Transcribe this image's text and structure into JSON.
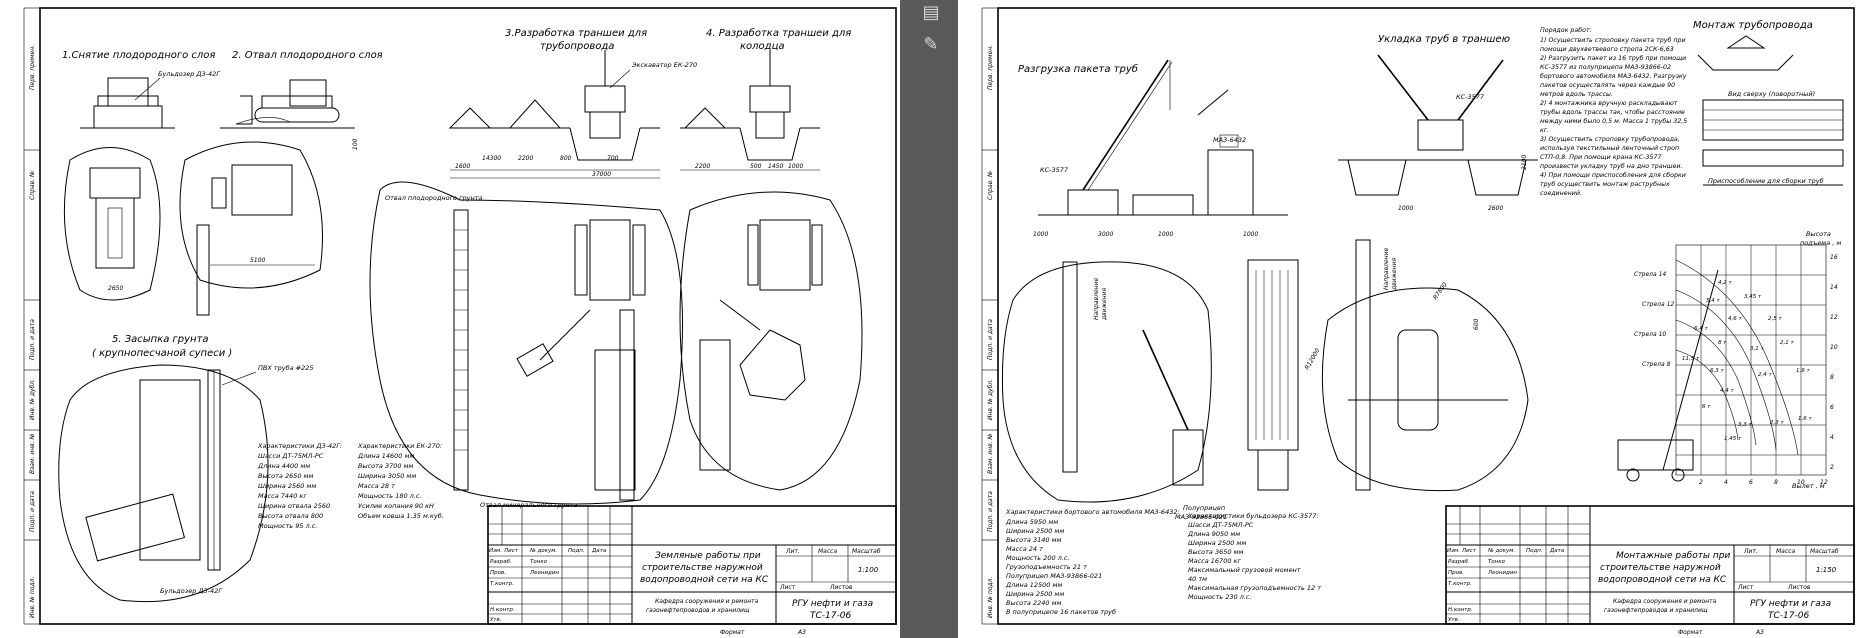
{
  "viewer": {
    "tools": [
      "layers-icon",
      "annotate-icon"
    ]
  },
  "left": {
    "h1": "1.Снятие плодородного слоя",
    "h2": "2. Отвал плодородного слоя",
    "h3a": "3.Разработка траншеи для",
    "h3b": "трубопровода",
    "h4a": "4. Разработка траншеи для",
    "h4b": "колодца",
    "h5a": "5. Засыпка грунта",
    "h5b": "( крупнопесчаной супеси )",
    "lbl_bulldozer": "Бульдозер ДЗ-42Г",
    "lbl_bulldozer2": "Бульдозер ДЗ-42Г",
    "lbl_excavator": "Экскаватор ЕК-270",
    "lbl_otval": "Отвал плодородного грунта",
    "lbl_otval_min": "Отвал минерального грунта",
    "lbl_pipe": "ПВХ труба #225",
    "dims": [
      "1600",
      "14300",
      "2200",
      "800",
      "2200",
      "700",
      "37000",
      "2200",
      "500",
      "1450",
      "1000",
      "5100",
      "2650",
      "1000",
      "100"
    ],
    "specs_dz_title": "Характеристики ДЗ-42Г:",
    "specs_dz": [
      "Шасси ДТ-75МЛ-РС",
      "Длина 4400 мм",
      "Высота 2650 мм",
      "Ширина 2560 мм",
      "Масса 7440 кг",
      "Ширина отвала 2560",
      "Высота отвала 800",
      "Мощность 95 л.с."
    ],
    "specs_ek_title": "Характеристики ЕК-270:",
    "specs_ek": [
      "Длина 14600 мм",
      "Высота 3700 мм",
      "Ширина 3050 мм",
      "Масса 28 т",
      "Мощность 180 л.с.",
      "Усилие копания 90 кН",
      "Объем ковша 1,35 м.куб."
    ],
    "side_labels": [
      "Перв. примен.",
      "Справ. №",
      "Подп. и дата",
      "Инв. № дубл.",
      "Взам. инв. №",
      "Подп. и дата",
      "Инв. № подл."
    ],
    "tb": {
      "title": [
        "Земляные работы при",
        "строительстве наружной",
        "водопроводной сети на КС"
      ],
      "hdr": [
        "Изм.",
        "Лист",
        "№ докум.",
        "Подп.",
        "Дата"
      ],
      "rows": [
        "Разраб.",
        "Пров.",
        "Т.контр.",
        "",
        "Н.контр.",
        "Утв."
      ],
      "names": [
        "Тонко",
        "Леонидин"
      ],
      "lit": "Лит.",
      "mass": "Масса",
      "scale_h": "Масштаб",
      "scale": "1:100",
      "sheet": "Лист",
      "sheets": "Листов",
      "dept": [
        "Кафедра сооружения и ремонта",
        "газонефтепроводов и хранилищ"
      ],
      "org": [
        "РГУ нефти и газа",
        "ТС-17-06"
      ],
      "format_l": "Формат",
      "format": "А3"
    }
  },
  "right": {
    "h_unload": "Разгрузка пакета труб",
    "h_lay": "Укладка труб в траншею",
    "h_mount": "Монтаж трубопровода",
    "proc_title": "Порядок работ:",
    "proc": [
      "1) Осуществить строповку пакета труб при",
      "помощи двухветвевого стропа 2СК-6,63",
      "2) Разгрузить пакет из 16 труб при помощи",
      "КС-3577 из полуприцепа МАЗ-93866-02",
      "бортового автомобиля МАЗ-6432. Разгрузку",
      "пакетов осуществлять через каждые 90",
      "метров вдоль трассы.",
      "2) 4 монтажника вручную раскладывают",
      "трубы вдоль трассы так, чтобы расстояние",
      "между ними было 0,5 м. Масса 1 трубы 32,5",
      "кг.",
      "3) Осуществить строповку трубопровода,",
      "используя текстильный ленточный строп",
      "СТП-0,8.  При помощи крана КС-3577",
      "произвести укладку труб на дно траншеи.",
      "4) При помощи приспособления для сборки",
      "труб осуществить монтаж раструбных",
      "соединений."
    ],
    "lbl_ks": "КС-3577",
    "lbl_ks2": "КС-3577",
    "lbl_maz": "МАЗ-6432",
    "lbl_pricep": [
      "Полуприцеп",
      "МАЗ-93866-021"
    ],
    "lbl_vid": "Вид сверху (поворотный)",
    "lbl_device": "Приспособление для сборки труб",
    "lbl_dir": [
      "Направление",
      "движения"
    ],
    "lbl_dir2": [
      "Направление",
      "движения"
    ],
    "dims": [
      "1000",
      "3000",
      "1000",
      "1000",
      "2100",
      "1000",
      "2600",
      "1000",
      "R12000",
      "R7800",
      "R5000",
      "600"
    ],
    "graph_title": [
      "Высота",
      "подъема , м"
    ],
    "graph_x": "Вылет , м",
    "graph_y": [
      "16",
      "14",
      "12",
      "10",
      "8",
      "6",
      "4",
      "2"
    ],
    "graph_xt": [
      "2",
      "4",
      "6",
      "8",
      "10",
      "12"
    ],
    "booms": [
      "Стрела 14",
      "Стрела 12",
      "Стрела 10",
      "Стрела 8"
    ],
    "loads": [
      "4,2 т",
      "3,45 т",
      "5,4 т",
      "2,5 т",
      "4,6 т",
      "6,4 т",
      "2,1 т",
      "8 т",
      "3,1 т",
      "11,5 т",
      "6,3 т",
      "2,4 т",
      "1,9 т",
      "4,4 т",
      "1,6 т",
      "6 т",
      "2,3 т",
      "3,3 т",
      "1,45 т"
    ],
    "specs_maz_title": "Характеристики бортового автомобиля МАЗ-6432:",
    "specs_maz": [
      "Длина 5950 мм",
      "Ширина 2500 мм",
      "Высота 3140 мм",
      "Масса 24 т",
      "Мощность 200 л.с.",
      "Грузоподъемность 21 т",
      "Полуприцеп МАЗ-93866-021",
      "Длина 12500 мм",
      "Ширина 2500 мм",
      "Высота 2240 мм",
      "В полуприцепе 16 пакетов труб"
    ],
    "specs_ks_title": "Характеристики бульдозера КС-3577:",
    "specs_ks": [
      "Шасси ДТ-75МЛ-РС",
      "Длина 9050 мм",
      "Ширина 2500 мм",
      "Высота 3650 мм",
      "Масса 16700 кг",
      "Максимальный грузовой момент",
      "40 тм",
      "Максимальная грузоподъемность  12 т",
      "Мощность  230 л.с."
    ],
    "tb": {
      "title": [
        "Монтажные работы при",
        "строительстве наружной",
        "водопроводной сети на КС"
      ],
      "hdr": [
        "Изм.",
        "Лист",
        "№ докум.",
        "Подп.",
        "Дата"
      ],
      "rows": [
        "Разраб.",
        "Пров.",
        "Т.контр.",
        "",
        "Н.контр.",
        "Утв."
      ],
      "names": [
        "Тонко",
        "Леонидин"
      ],
      "lit": "Лит.",
      "mass": "Масса",
      "scale_h": "Масштаб",
      "scale": "1:150",
      "sheet": "Лист",
      "sheets": "Листов",
      "dept": [
        "Кафедра сооружения и ремонта",
        "газонефтепроводов и хранилищ"
      ],
      "org": [
        "РГУ нефти и газа",
        "ТС-17-06"
      ],
      "format_l": "Формат",
      "format": "А3"
    }
  }
}
